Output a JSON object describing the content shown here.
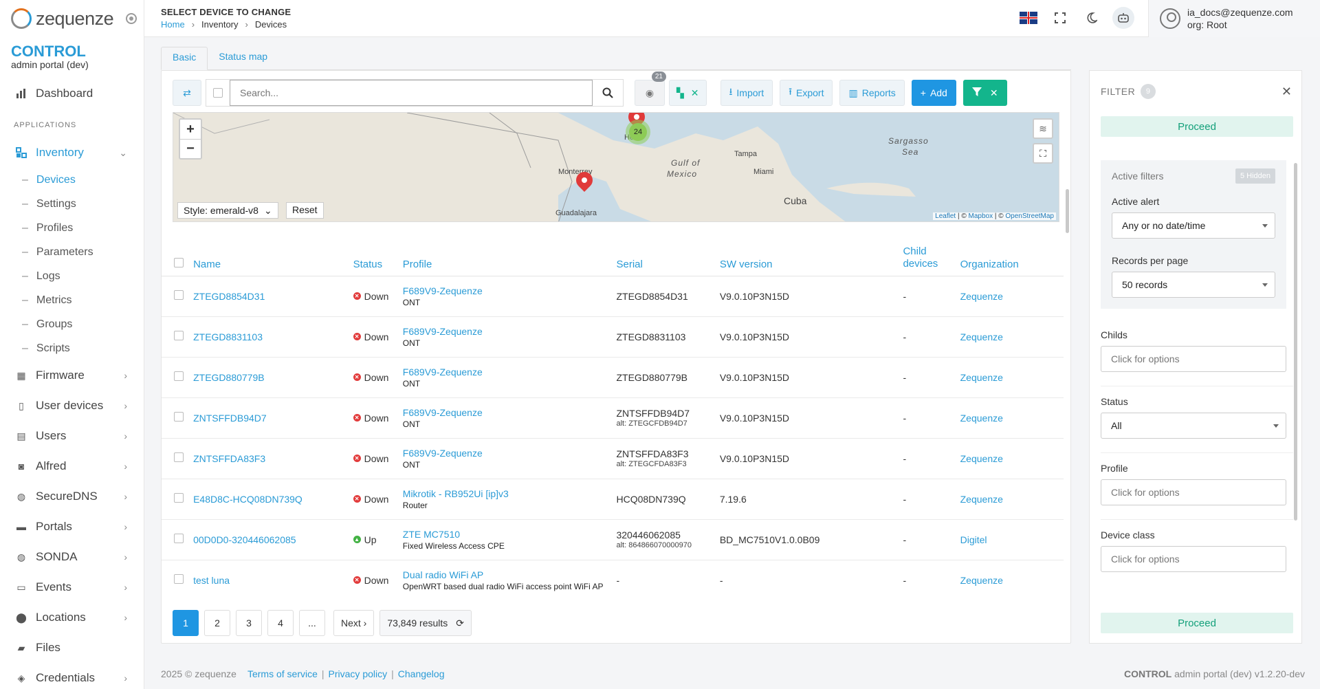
{
  "brand": {
    "name": "zequenze",
    "control": "CONTROL",
    "subtitle": "admin portal (dev)"
  },
  "sidebar": {
    "dashboard": "Dashboard",
    "section": "APPLICATIONS",
    "items": [
      {
        "label": "Inventory",
        "icon": "inventory-icon"
      },
      {
        "label": "Firmware",
        "icon": "firmware-icon"
      },
      {
        "label": "User devices",
        "icon": "tablet-icon"
      },
      {
        "label": "Users",
        "icon": "users-icon"
      },
      {
        "label": "Alfred",
        "icon": "robot-icon"
      },
      {
        "label": "SecureDNS",
        "icon": "globe-icon"
      },
      {
        "label": "Portals",
        "icon": "portal-icon"
      },
      {
        "label": "SONDA",
        "icon": "globe-icon"
      },
      {
        "label": "Events",
        "icon": "events-icon"
      },
      {
        "label": "Locations",
        "icon": "location-icon"
      },
      {
        "label": "Files",
        "icon": "folder-icon"
      },
      {
        "label": "Credentials",
        "icon": "shield-icon"
      }
    ],
    "inventory_sub": [
      "Devices",
      "Settings",
      "Profiles",
      "Parameters",
      "Logs",
      "Metrics",
      "Groups",
      "Scripts"
    ]
  },
  "header": {
    "title": "SELECT DEVICE TO CHANGE",
    "breadcrumb": [
      "Home",
      "Inventory",
      "Devices"
    ],
    "user_email": "ia_docs@zequenze.com",
    "user_org": "org: Root"
  },
  "tabs": [
    "Basic",
    "Status map"
  ],
  "toolbar": {
    "search_placeholder": "Search...",
    "visibility_count": "21",
    "import": "Import",
    "export": "Export",
    "reports": "Reports",
    "add": "Add"
  },
  "map": {
    "style": "Style: emerald-v8",
    "reset": "Reset",
    "cluster": "24",
    "labels": {
      "gulf": "Gulf of",
      "gulf2": "Mexico",
      "sargasso": "Sargasso",
      "sea": "Sea"
    },
    "cities": [
      "Monterrey",
      "Tampa",
      "Miami",
      "Cuba",
      "Guadalajara",
      "Ho"
    ],
    "attribution": {
      "leaflet": "Leaflet",
      "mapbox": "Mapbox",
      "osm": "OpenStreetMap",
      "sep1": " | © ",
      "sep2": " | © "
    }
  },
  "table": {
    "headers": {
      "name": "Name",
      "status": "Status",
      "profile": "Profile",
      "serial": "Serial",
      "sw": "SW version",
      "child": "Child devices",
      "org": "Organization"
    },
    "rows": [
      {
        "name": "ZTEGD8854D31",
        "status": "Down",
        "profile": "F689V9-Zequenze",
        "profile_sub": "ONT",
        "serial": "ZTEGD8854D31",
        "serial_alt": "",
        "sw": "V9.0.10P3N15D",
        "child": "-",
        "org": "Zequenze"
      },
      {
        "name": "ZTEGD8831103",
        "status": "Down",
        "profile": "F689V9-Zequenze",
        "profile_sub": "ONT",
        "serial": "ZTEGD8831103",
        "serial_alt": "",
        "sw": "V9.0.10P3N15D",
        "child": "-",
        "org": "Zequenze"
      },
      {
        "name": "ZTEGD880779B",
        "status": "Down",
        "profile": "F689V9-Zequenze",
        "profile_sub": "ONT",
        "serial": "ZTEGD880779B",
        "serial_alt": "",
        "sw": "V9.0.10P3N15D",
        "child": "-",
        "org": "Zequenze"
      },
      {
        "name": "ZNTSFFDB94D7",
        "status": "Down",
        "profile": "F689V9-Zequenze",
        "profile_sub": "ONT",
        "serial": "ZNTSFFDB94D7",
        "serial_alt": "alt: ZTEGCFDB94D7",
        "sw": "V9.0.10P3N15D",
        "child": "-",
        "org": "Zequenze"
      },
      {
        "name": "ZNTSFFDA83F3",
        "status": "Down",
        "profile": "F689V9-Zequenze",
        "profile_sub": "ONT",
        "serial": "ZNTSFFDA83F3",
        "serial_alt": "alt: ZTEGCFDA83F3",
        "sw": "V9.0.10P3N15D",
        "child": "-",
        "org": "Zequenze"
      },
      {
        "name": "E48D8C-HCQ08DN739Q",
        "status": "Down",
        "profile": "Mikrotik - RB952Ui [ip]v3",
        "profile_sub": "Router",
        "serial": "HCQ08DN739Q",
        "serial_alt": "",
        "sw": "7.19.6",
        "child": "-",
        "org": "Zequenze"
      },
      {
        "name": "00D0D0-320446062085",
        "status": "Up",
        "profile": "ZTE MC7510",
        "profile_sub": "Fixed Wireless Access CPE",
        "serial": "320446062085",
        "serial_alt": "alt: 864866070000970",
        "sw": "BD_MC7510V1.0.0B09",
        "child": "-",
        "org": "Digitel"
      },
      {
        "name": "test luna",
        "status": "Down",
        "profile": "Dual radio WiFi AP",
        "profile_sub": "OpenWRT based dual radio WiFi access point WiFi AP",
        "serial": "-",
        "serial_alt": "",
        "sw": "-",
        "child": "-",
        "org": "Zequenze"
      }
    ]
  },
  "pagination": {
    "pages": [
      "1",
      "2",
      "3",
      "4",
      "..."
    ],
    "next": "Next ›",
    "results": "73,849 results"
  },
  "filter": {
    "title": "FILTER",
    "count": "9",
    "proceed": "Proceed",
    "active_filters": "Active filters",
    "hidden": "5 Hidden",
    "active_alert_label": "Active alert",
    "active_alert_value": "Any or no date/time",
    "records_label": "Records per page",
    "records_value": "50 records",
    "childs_label": "Childs",
    "status_label": "Status",
    "status_value": "All",
    "profile_label": "Profile",
    "device_class_label": "Device class",
    "placeholder": "Click for options"
  },
  "footer": {
    "copyright": "2025 © zequenze",
    "terms": "Terms of service",
    "privacy": "Privacy policy",
    "changelog": "Changelog",
    "bar": "|",
    "product": "CONTROL",
    "version": "admin portal (dev) v1.2.20-dev"
  }
}
